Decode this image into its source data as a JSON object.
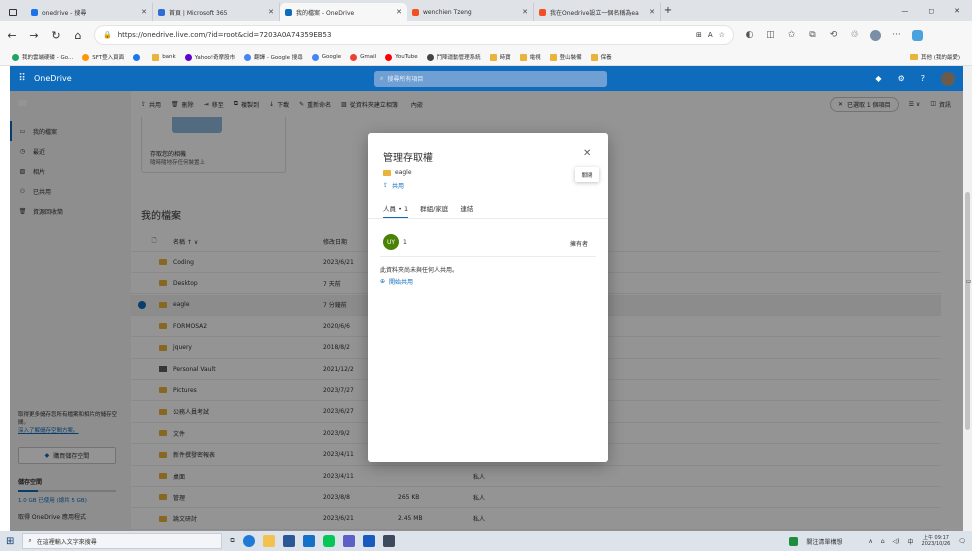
{
  "browser": {
    "tabs": [
      {
        "title": "onedrive - 搜尋",
        "icon_color": "#1a73e8",
        "active": false
      },
      {
        "title": "首頁 | Microsoft 365",
        "icon_color": "#2f6cd6",
        "active": false
      },
      {
        "title": "我的檔案 - OneDrive",
        "icon_color": "#0f6cbd",
        "active": true
      },
      {
        "title": "wenchien Tzeng",
        "icon_color": "#f25022",
        "active": false
      },
      {
        "title": "我在Onedrive設立一個名稱為ea",
        "icon_color": "#f25022",
        "active": false
      }
    ],
    "new_tab": "+",
    "window_controls": [
      "—",
      "◻",
      "✕"
    ],
    "url": "https://onedrive.live.com/?id=root&cid=7203A0A74359EB53",
    "bookmarks": [
      {
        "label": "我的雲端硬碟 - Go...",
        "icon": "drive-icon"
      },
      {
        "label": "SFT登入頁面",
        "icon": "sft-icon"
      },
      {
        "label": "",
        "icon": "facebook-icon"
      },
      {
        "label": "bank",
        "icon": "folder-icon"
      },
      {
        "label": "Yahoo!奇摩股市",
        "icon": "yahoo-icon"
      },
      {
        "label": "翻譯 - Google 搜尋",
        "icon": "google-icon"
      },
      {
        "label": "Google",
        "icon": "google-icon"
      },
      {
        "label": "Gmail",
        "icon": "gmail-icon"
      },
      {
        "label": "YouTube",
        "icon": "youtube-icon"
      },
      {
        "label": "鬥陣運動管理系統",
        "icon": "sport-icon"
      },
      {
        "label": "時寶",
        "icon": "folder-icon"
      },
      {
        "label": "電視",
        "icon": "folder-icon"
      },
      {
        "label": "登山裝備",
        "icon": "folder-icon"
      },
      {
        "label": "保養",
        "icon": "folder-icon"
      }
    ],
    "other_favorites": "其他 (我的最愛)"
  },
  "onedrive": {
    "brand": "OneDrive",
    "search_placeholder": "搜尋所有項目",
    "nav": [
      {
        "label": "我的檔案",
        "icon": "folder-icon",
        "selected": true
      },
      {
        "label": "最近",
        "icon": "clock-icon",
        "selected": false
      },
      {
        "label": "相片",
        "icon": "photo-icon",
        "selected": false
      },
      {
        "label": "已共用",
        "icon": "people-icon",
        "selected": false
      },
      {
        "label": "資源回收筒",
        "icon": "trash-icon",
        "selected": false
      }
    ],
    "storage_promo": "取得更多儲存您所有檔案和相片的儲存空間。",
    "storage_link": "深入了解儲存空間方案。",
    "buy_storage": "購買儲存空間",
    "storage_title": "儲存空間",
    "storage_used": "1.0 GB 已使用 (總共 5 GB)",
    "get_apps": "取得 OneDrive 應用程式",
    "commands": [
      {
        "label": "共用",
        "icon": "share-icon"
      },
      {
        "label": "刪除",
        "icon": "delete-icon"
      },
      {
        "label": "移至",
        "icon": "move-icon"
      },
      {
        "label": "複製到",
        "icon": "copy-icon"
      },
      {
        "label": "下載",
        "icon": "download-icon"
      },
      {
        "label": "重新命名",
        "icon": "rename-icon"
      },
      {
        "label": "從資料夾建立相簿",
        "icon": "album-icon"
      },
      {
        "label": "內嵌",
        "icon": "embed-icon"
      }
    ],
    "selected_badge": "已選取 1 個項目",
    "view_label": "",
    "info_label": "資訊",
    "card_title": "存取您的相機",
    "card_sub": "隨時隨地存任何裝置上",
    "section_title": "我的檔案",
    "columns": {
      "name": "名稱 ↑ ∨",
      "modified": "修改日期",
      "size": "",
      "sharing": ""
    },
    "files": [
      {
        "name": "Coding",
        "modified": "2023/6/21",
        "size": "",
        "sharing": "",
        "selected": false,
        "icon": "folder-icon"
      },
      {
        "name": "Desktop",
        "modified": "7 天前",
        "size": "",
        "sharing": "",
        "selected": false,
        "icon": "folder-icon"
      },
      {
        "name": "eagle",
        "modified": "7 分鐘前",
        "size": "",
        "sharing": "",
        "selected": true,
        "icon": "folder-icon"
      },
      {
        "name": "FORMOSA2",
        "modified": "2020/6/6",
        "size": "",
        "sharing": "",
        "selected": false,
        "icon": "folder-icon"
      },
      {
        "name": "jquery",
        "modified": "2018/8/2",
        "size": "",
        "sharing": "",
        "selected": false,
        "icon": "folder-icon"
      },
      {
        "name": "Personal Vault",
        "modified": "2021/12/2",
        "size": "",
        "sharing": "",
        "selected": false,
        "icon": "vault-icon"
      },
      {
        "name": "Pictures",
        "modified": "2023/7/27",
        "size": "",
        "sharing": "",
        "selected": false,
        "icon": "folder-icon"
      },
      {
        "name": "公務人員考試",
        "modified": "2023/6/27",
        "size": "",
        "sharing": "",
        "selected": false,
        "icon": "folder-icon"
      },
      {
        "name": "文件",
        "modified": "2023/9/2",
        "size": "",
        "sharing": "",
        "selected": false,
        "icon": "folder-icon"
      },
      {
        "name": "新件撰發密報表",
        "modified": "2023/4/11",
        "size": "",
        "sharing": "",
        "selected": false,
        "icon": "folder-icon"
      },
      {
        "name": "桌面",
        "modified": "2023/4/11",
        "size": "",
        "sharing": "私人",
        "selected": false,
        "icon": "folder-icon"
      },
      {
        "name": "管理",
        "modified": "2023/8/8",
        "size": "265 KB",
        "sharing": "私人",
        "selected": false,
        "icon": "folder-icon"
      },
      {
        "name": "論文研討",
        "modified": "2023/6/21",
        "size": "2.45 MB",
        "sharing": "私人",
        "selected": false,
        "icon": "folder-icon"
      }
    ]
  },
  "dialog": {
    "title": "管理存取權",
    "close_tooltip": "關閉",
    "item_name": "eagle",
    "share_link": "共用",
    "tabs": [
      {
        "label": "人員 • 1",
        "active": true
      },
      {
        "label": "群組/家庭",
        "active": false
      },
      {
        "label": "連結",
        "active": false
      }
    ],
    "person_initials": "UY",
    "person_name": "1",
    "person_role": "擁有者",
    "avatar_color": "#498205",
    "not_shared_text": "此資料夾尚未與任何人共用。",
    "start_sharing": "開始共用"
  },
  "taskbar": {
    "search_placeholder": "在這裡輸入文字來搜尋",
    "notification": "關注清單構想",
    "time": "上午 09:17",
    "date": "2023/10/26",
    "lang": "中"
  },
  "colors": {
    "accent": "#0f6cbd",
    "folder": "#e8b43b"
  }
}
